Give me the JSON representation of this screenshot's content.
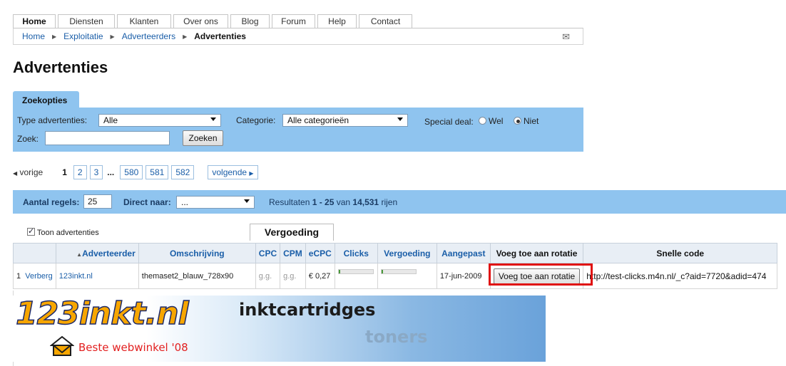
{
  "tabs": [
    "Home",
    "Diensten",
    "Klanten",
    "Over ons",
    "Blog",
    "Forum",
    "Help",
    "Contact"
  ],
  "breadcrumb": [
    "Home",
    "Exploitatie",
    "Adverteerders",
    "Advertenties"
  ],
  "page_title": "Advertenties",
  "search": {
    "tab_label": "Zoekopties",
    "type_label": "Type advertenties:",
    "type_value": "Alle",
    "categorie_label": "Categorie:",
    "categorie_value": "Alle categorieën",
    "special_label": "Special deal:",
    "wel_label": "Wel",
    "niet_label": "Niet",
    "zoek_label": "Zoek:",
    "zoek_value": "",
    "zoeken_button": "Zoeken"
  },
  "pager": {
    "prev": "vorige",
    "current": "1",
    "pages": [
      "2",
      "3"
    ],
    "ellipsis": "...",
    "last_pages": [
      "580",
      "581",
      "582"
    ],
    "next": "volgende"
  },
  "results_bar": {
    "aantal_label": "Aantal regels:",
    "aantal_value": "25",
    "direct_label": "Direct naar:",
    "direct_value": "...",
    "resultaten_prefix": "Resultaten ",
    "range": "1 - 25",
    "van": " van ",
    "total": "14,531",
    "rijen": " rijen"
  },
  "toon_label": "Toon advertenties",
  "vergoeding_tab": "Vergoeding",
  "columns": [
    "Adverteerder",
    "Omschrijving",
    "CPC",
    "CPM",
    "eCPC",
    "Clicks",
    "Vergoeding",
    "Aangepast",
    "Voeg toe aan rotatie",
    "Snelle code"
  ],
  "rows": [
    {
      "num": "1",
      "action": "Verberg",
      "adverteerder": "123inkt.nl",
      "omschrijving": "themaset2_blauw_728x90",
      "cpc": "g.g.",
      "cpm": "g.g.",
      "ecpc": "€ 0,27",
      "aangepast": "17-jun-2009",
      "rotatie_button": "Voeg toe aan rotatie",
      "snelle_code": "http://test-clicks.m4n.nl/_c?aid=7720&adid=474"
    }
  ],
  "banner": {
    "logo": "123inkt.nl",
    "tagline": "Beste webwinkel '08",
    "word1": "inktcartridges",
    "word2": "toners"
  },
  "icons": [
    "mail-icon",
    "arrow-left-icon",
    "arrow-right-icon",
    "chevron-down-icon",
    "house-logo-icon"
  ]
}
